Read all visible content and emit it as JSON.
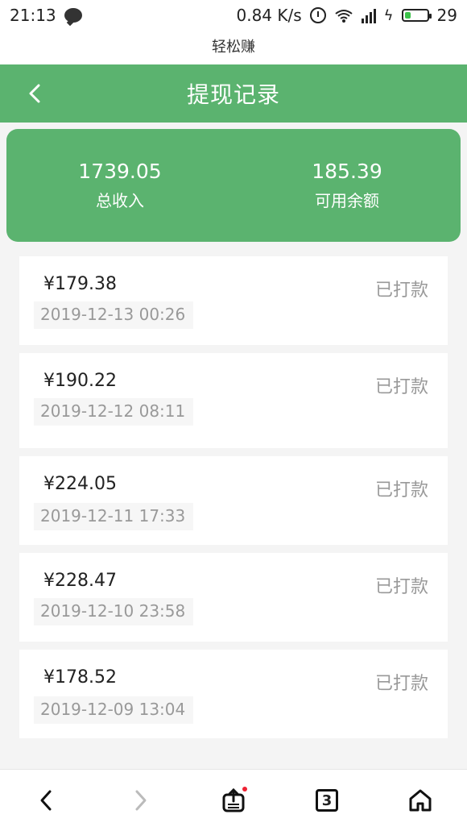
{
  "status": {
    "time": "21:13",
    "speed": "0.84 K/s",
    "battery": "29"
  },
  "host_title": "轻松赚",
  "header": {
    "title": "提现记录"
  },
  "summary": {
    "total_income": "1739.05",
    "total_income_label": "总收入",
    "available": "185.39",
    "available_label": "可用余额"
  },
  "records": [
    {
      "amount": "¥179.38",
      "date": "2019-12-13 00:26",
      "state": "已打款"
    },
    {
      "amount": "¥190.22",
      "date": "2019-12-12 08:11",
      "state": "已打款"
    },
    {
      "amount": "¥224.05",
      "date": "2019-12-11 17:33",
      "state": "已打款"
    },
    {
      "amount": "¥228.47",
      "date": "2019-12-10 23:58",
      "state": "已打款"
    },
    {
      "amount": "¥178.52",
      "date": "2019-12-09 13:04",
      "state": "已打款"
    }
  ],
  "bottombar": {
    "tab_count": "3"
  },
  "colors": {
    "brand_green": "#5bb36f",
    "muted_text": "#999999"
  }
}
